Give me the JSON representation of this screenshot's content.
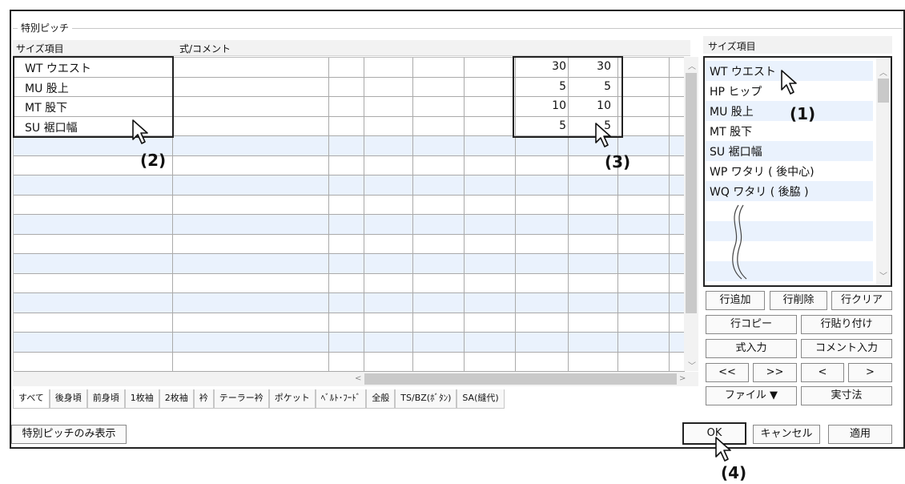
{
  "group_title": "特別ピッチ",
  "grid": {
    "col_size_header": "サイズ項目",
    "col_formula_header": "式/コメント",
    "rows": [
      {
        "label": "WT  ウエスト",
        "v1": "30",
        "v2": "30"
      },
      {
        "label": "MU  股上",
        "v1": "5",
        "v2": "5"
      },
      {
        "label": "MT  股下",
        "v1": "10",
        "v2": "10"
      },
      {
        "label": "SU  裾口幅",
        "v1": "5",
        "v2": "5"
      }
    ]
  },
  "tabs": [
    "すべて",
    "後身頃",
    "前身頃",
    "1枚袖",
    "2枚袖",
    "衿",
    "テーラー衿",
    "ポケット",
    "ﾍﾞﾙﾄ･ﾌｰﾄﾞ",
    "全般",
    "TS/BZ(ﾎﾞﾀﾝ)",
    "SA(縫代)"
  ],
  "right_panel": {
    "header": "サイズ項目",
    "items": [
      "WT  ウエスト",
      "HP  ヒップ",
      "MU  股上",
      "MT  股下",
      "SU  裾口幅",
      "WP  ワタリ ( 後中心)",
      "WQ  ワタリ ( 後脇 )"
    ]
  },
  "buttons": {
    "add_row": "行追加",
    "delete_row": "行削除",
    "clear_row": "行クリア",
    "copy_row": "行コピー",
    "paste_row": "行貼り付け",
    "formula_input": "式入力",
    "comment_input": "コメント入力",
    "first": "<<",
    "last": ">>",
    "prev": "<",
    "next": ">",
    "file": "ファイル ▼",
    "actual_size": "実寸法",
    "show_special": "特別ピッチのみ表示",
    "ok": "OK",
    "cancel": "キャンセル",
    "apply": "適用"
  },
  "callouts": {
    "c1": "(1)",
    "c2": "(2)",
    "c3": "(3)",
    "c4": "(4)"
  }
}
